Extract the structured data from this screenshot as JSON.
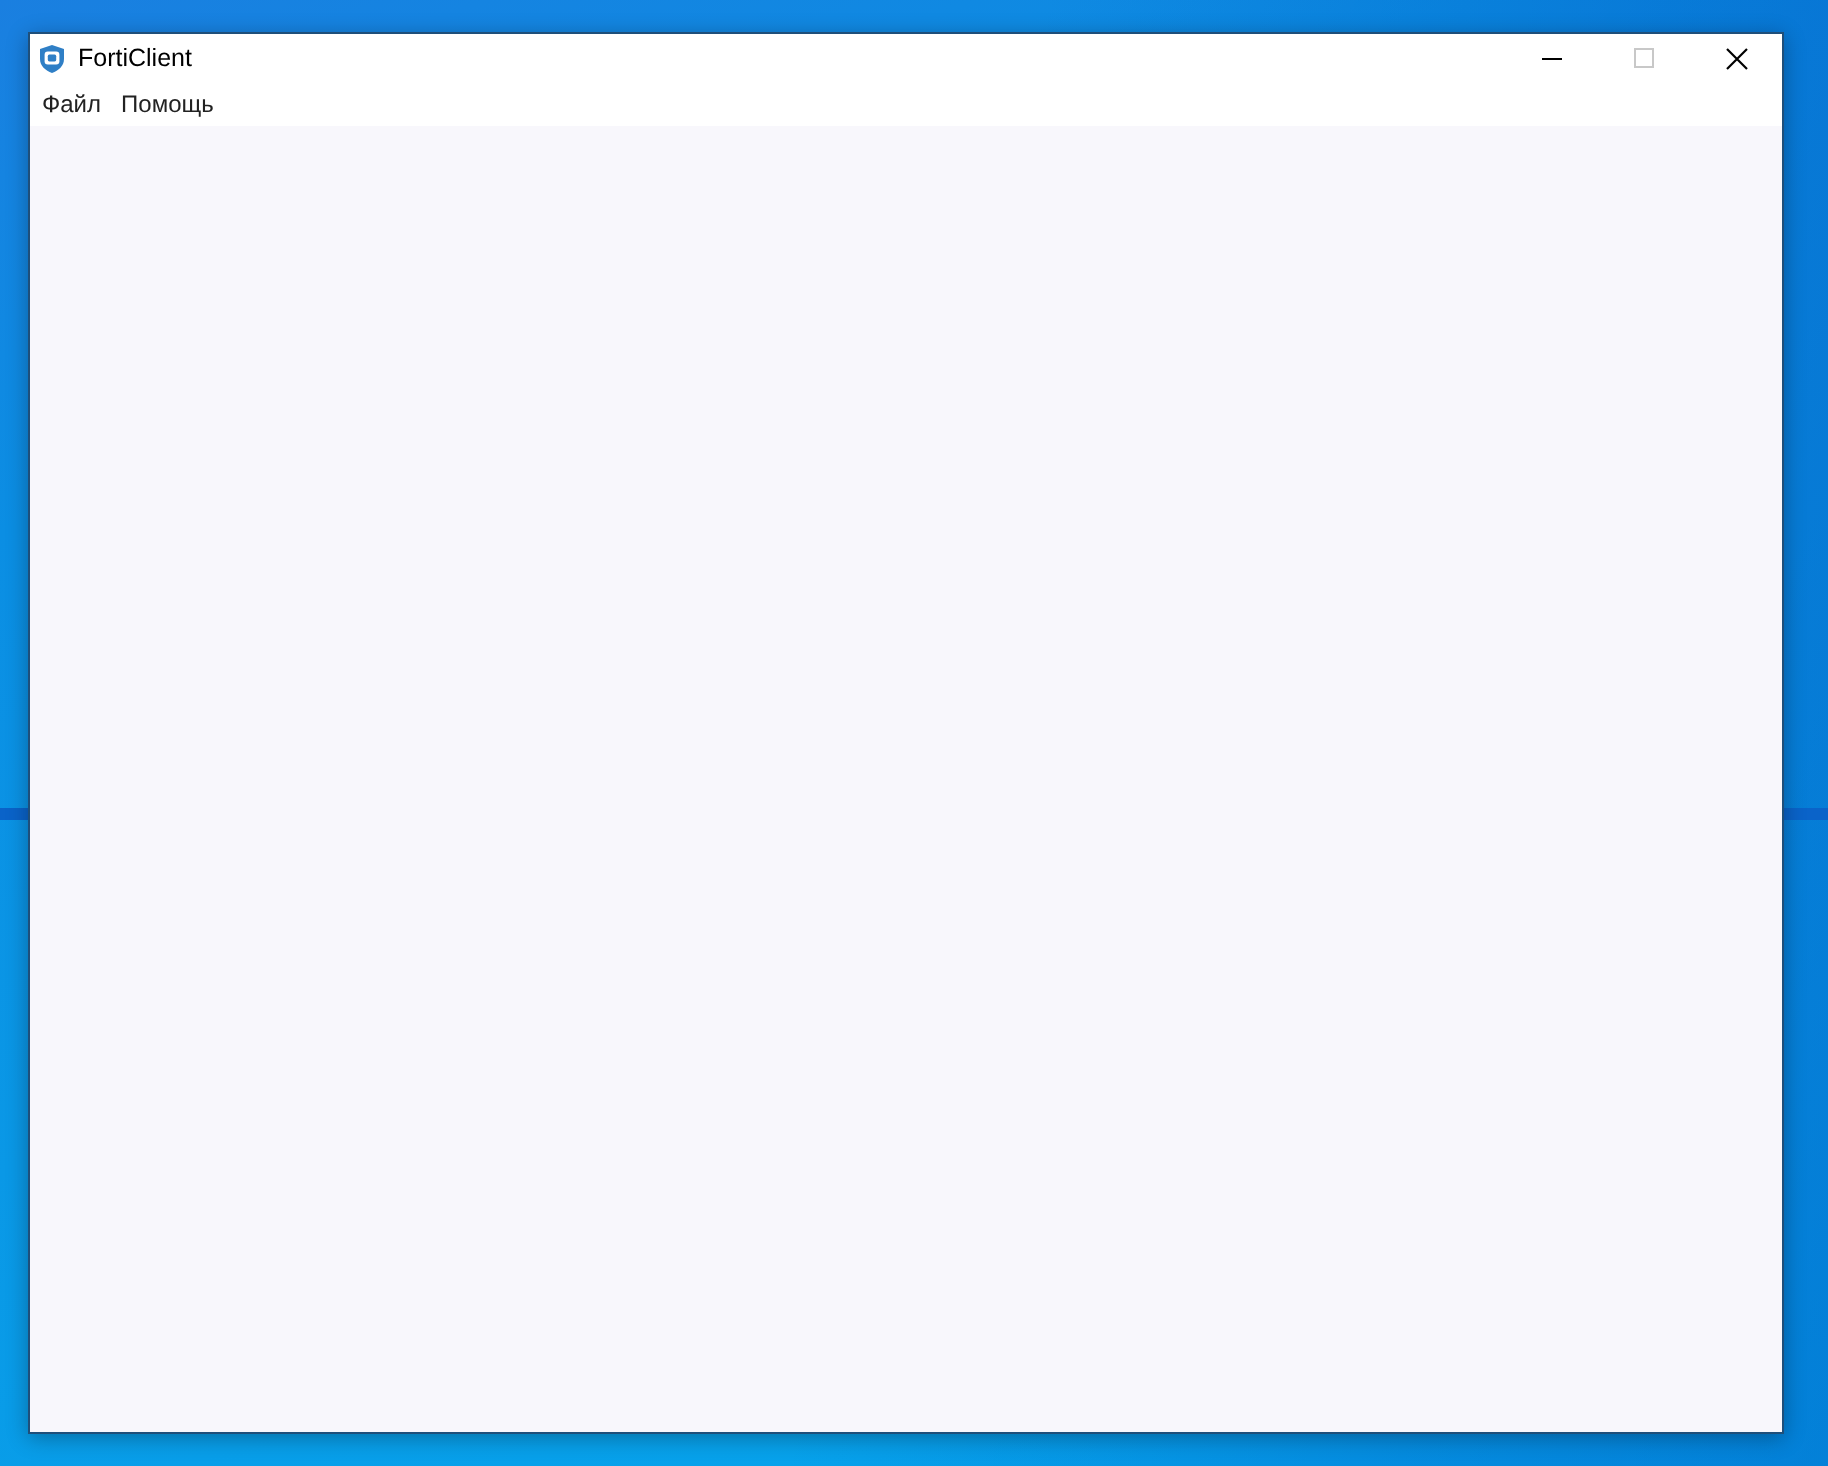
{
  "window": {
    "title": "FortiClient",
    "controls": [
      {
        "kind": "minimize",
        "disabled": false
      },
      {
        "kind": "maximize",
        "disabled": true
      },
      {
        "kind": "close",
        "disabled": false
      }
    ]
  },
  "menu": [
    {
      "label": "Файл"
    },
    {
      "label": "Помощь"
    }
  ]
}
